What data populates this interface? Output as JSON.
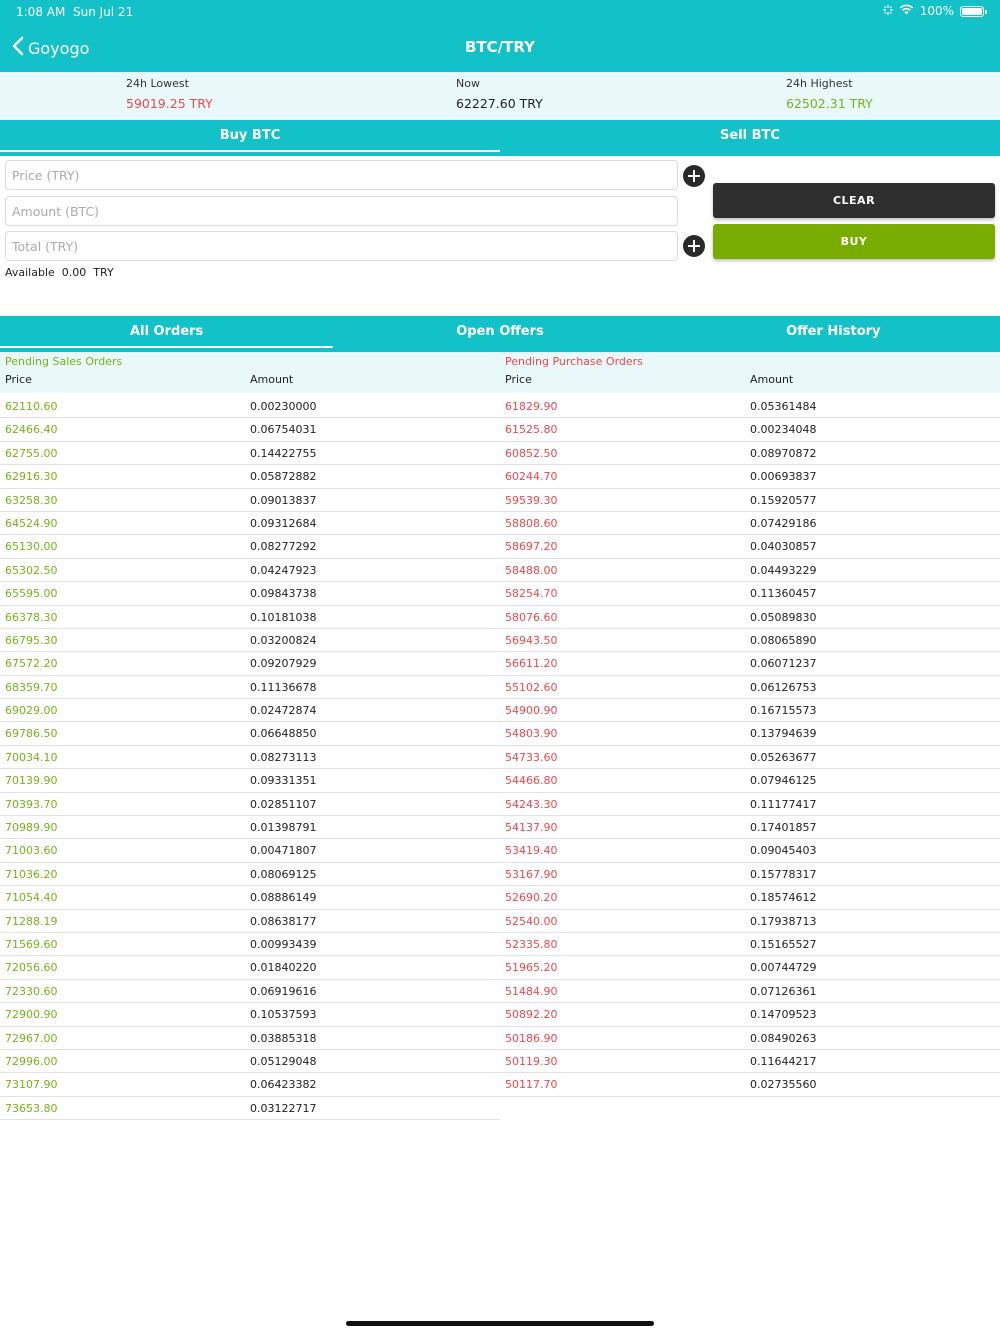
{
  "status": {
    "time": "1:08 AM",
    "date": "Sun Jul 21",
    "battery": "100%"
  },
  "nav": {
    "back_label": "Goyogo",
    "title": "BTC/TRY"
  },
  "stats": {
    "lowest_label": "24h Lowest",
    "lowest_value": "59019.25 TRY",
    "now_label": "Now",
    "now_value": "62227.60 TRY",
    "highest_label": "24h Highest",
    "highest_value": "62502.31 TRY"
  },
  "trade_tabs": {
    "buy": "Buy BTC",
    "sell": "Sell BTC"
  },
  "form": {
    "price_placeholder": "Price (TRY)",
    "amount_placeholder": "Amount (BTC)",
    "total_placeholder": "Total (TRY)",
    "clear_label": "CLEAR",
    "buy_label": "BUY",
    "available_label": "Available",
    "available_value": "0.00",
    "available_currency": "TRY"
  },
  "order_tabs": {
    "all": "All Orders",
    "open": "Open Offers",
    "history": "Offer History"
  },
  "orders": {
    "sales_title": "Pending Sales Orders",
    "purchase_title": "Pending Purchase Orders",
    "price_header": "Price",
    "amount_header": "Amount",
    "sales": [
      [
        "62110.60",
        "0.00230000"
      ],
      [
        "62466.40",
        "0.06754031"
      ],
      [
        "62755.00",
        "0.14422755"
      ],
      [
        "62916.30",
        "0.05872882"
      ],
      [
        "63258.30",
        "0.09013837"
      ],
      [
        "64524.90",
        "0.09312684"
      ],
      [
        "65130.00",
        "0.08277292"
      ],
      [
        "65302.50",
        "0.04247923"
      ],
      [
        "65595.00",
        "0.09843738"
      ],
      [
        "66378.30",
        "0.10181038"
      ],
      [
        "66795.30",
        "0.03200824"
      ],
      [
        "67572.20",
        "0.09207929"
      ],
      [
        "68359.70",
        "0.11136678"
      ],
      [
        "69029.00",
        "0.02472874"
      ],
      [
        "69786.50",
        "0.06648850"
      ],
      [
        "70034.10",
        "0.08273113"
      ],
      [
        "70139.90",
        "0.09331351"
      ],
      [
        "70393.70",
        "0.02851107"
      ],
      [
        "70989.90",
        "0.01398791"
      ],
      [
        "71003.60",
        "0.00471807"
      ],
      [
        "71036.20",
        "0.08069125"
      ],
      [
        "71054.40",
        "0.08886149"
      ],
      [
        "71288.19",
        "0.08638177"
      ],
      [
        "71569.60",
        "0.00993439"
      ],
      [
        "72056.60",
        "0.01840220"
      ],
      [
        "72330.60",
        "0.06919616"
      ],
      [
        "72900.90",
        "0.10537593"
      ],
      [
        "72967.00",
        "0.03885318"
      ],
      [
        "72996.00",
        "0.05129048"
      ],
      [
        "73107.90",
        "0.06423382"
      ],
      [
        "73653.80",
        "0.03122717"
      ]
    ],
    "purchases": [
      [
        "61829.90",
        "0.05361484"
      ],
      [
        "61525.80",
        "0.00234048"
      ],
      [
        "60852.50",
        "0.08970872"
      ],
      [
        "60244.70",
        "0.00693837"
      ],
      [
        "59539.30",
        "0.15920577"
      ],
      [
        "58808.60",
        "0.07429186"
      ],
      [
        "58697.20",
        "0.04030857"
      ],
      [
        "58488.00",
        "0.04493229"
      ],
      [
        "58254.70",
        "0.11360457"
      ],
      [
        "58076.60",
        "0.05089830"
      ],
      [
        "56943.50",
        "0.08065890"
      ],
      [
        "56611.20",
        "0.06071237"
      ],
      [
        "55102.60",
        "0.06126753"
      ],
      [
        "54900.90",
        "0.16715573"
      ],
      [
        "54803.90",
        "0.13794639"
      ],
      [
        "54733.60",
        "0.05263677"
      ],
      [
        "54466.80",
        "0.07946125"
      ],
      [
        "54243.30",
        "0.11177417"
      ],
      [
        "54137.90",
        "0.17401857"
      ],
      [
        "53419.40",
        "0.09045403"
      ],
      [
        "53167.90",
        "0.15778317"
      ],
      [
        "52690.20",
        "0.18574612"
      ],
      [
        "52540.00",
        "0.17938713"
      ],
      [
        "52335.80",
        "0.15165527"
      ],
      [
        "51965.20",
        "0.00744729"
      ],
      [
        "51484.90",
        "0.07126361"
      ],
      [
        "50892.20",
        "0.14709523"
      ],
      [
        "50186.90",
        "0.08490263"
      ],
      [
        "50119.30",
        "0.11644217"
      ],
      [
        "50117.70",
        "0.02735560"
      ]
    ]
  },
  "colors": {
    "teal": "#12c2c8",
    "sell_green": "#76b31b",
    "buy_red": "#f0484e",
    "clear_button": "#2f2f2f",
    "buy_button": "#78ad00"
  }
}
